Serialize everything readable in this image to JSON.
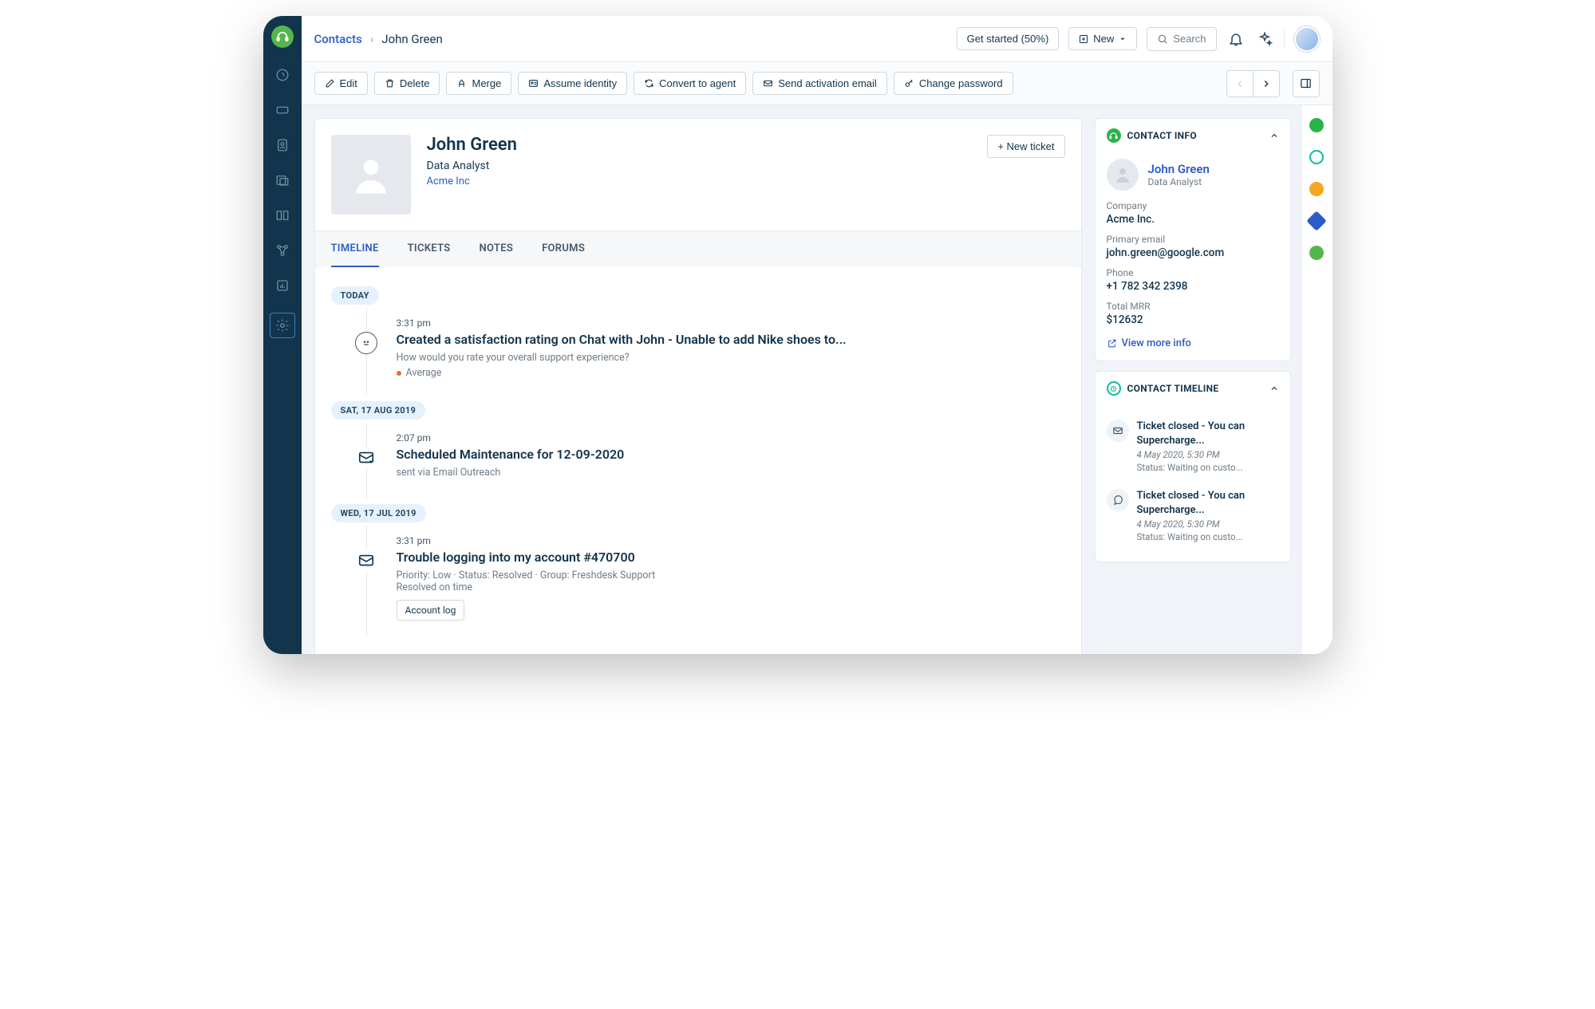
{
  "breadcrumb": {
    "root": "Contacts",
    "current": "John Green"
  },
  "header": {
    "get_started": "Get started (50%)",
    "new_label": "New",
    "search_placeholder": "Search"
  },
  "actions": {
    "edit": "Edit",
    "delete": "Delete",
    "merge": "Merge",
    "assume": "Assume identity",
    "convert": "Convert to agent",
    "send_activation": "Send activation email",
    "change_password": "Change password"
  },
  "profile": {
    "name": "John Green",
    "role": "Data Analyst",
    "company": "Acme Inc",
    "new_ticket": "+ New ticket"
  },
  "tabs": {
    "timeline": "TIMELINE",
    "tickets": "TICKETS",
    "notes": "NOTES",
    "forums": "FORUMS"
  },
  "timeline": {
    "d0": "TODAY",
    "i0": {
      "time": "3:31 pm",
      "title": "Created a satisfaction rating on Chat with John - Unable to add Nike shoes to...",
      "sub": "How would you rate your overall support experience?",
      "rating": "Average"
    },
    "d1": "SAT, 17 AUG 2019",
    "i1": {
      "time": "2:07 pm",
      "title": "Scheduled Maintenance for 12-09-2020",
      "sub": "sent via Email Outreach"
    },
    "d2": "WED, 17 JUL 2019",
    "i2": {
      "time": "3:31 pm",
      "title": "Trouble logging into my account #470700",
      "meta": "Priority: Low   ·   Status: Resolved   ·   Group: Freshdesk Support",
      "resolved": "Resolved on time",
      "tag": "Account log"
    }
  },
  "contact_info": {
    "title": "CONTACT INFO",
    "name": "John Green",
    "role": "Data Analyst",
    "company_label": "Company",
    "company": "Acme Inc.",
    "email_label": "Primary email",
    "email": "john.green@google.com",
    "phone_label": "Phone",
    "phone": "+1 782 342 2398",
    "mrr_label": "Total MRR",
    "mrr": "$12632",
    "view_more": "View more info"
  },
  "contact_timeline": {
    "title": "CONTACT TIMELINE",
    "items": [
      {
        "title": "Ticket closed - You can Supercharge...",
        "meta": "4 May 2020, 5:30 PM",
        "status": "Status: Waiting on custo..."
      },
      {
        "title": "Ticket closed - You can Supercharge...",
        "meta": "4 May 2020, 5:30 PM",
        "status": "Status: Waiting on custo..."
      }
    ]
  },
  "rail_colors": [
    "#2ab34a",
    "#0fbd9d",
    "#f5a623",
    "#2c5cc5",
    "#54b74a"
  ]
}
